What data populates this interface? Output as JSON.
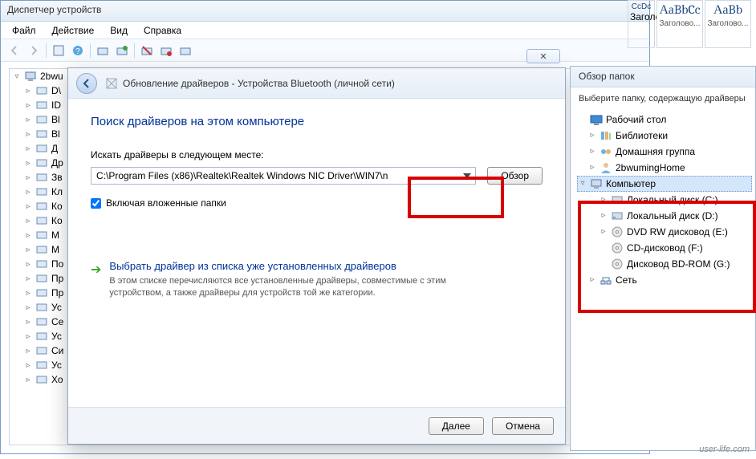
{
  "devmgr": {
    "title": "Диспетчер устройств",
    "menu": [
      "Файл",
      "Действие",
      "Вид",
      "Справка"
    ],
    "root": "2bwu",
    "nodes": [
      "D\\",
      "ID",
      "Bl",
      "Bl",
      "Д",
      "Др",
      "Зв",
      "Кл",
      "Ко",
      "Ко",
      "М",
      "М",
      "По",
      "Пр",
      "Пр",
      "Ус",
      "Се",
      "Ус",
      "Си",
      "Ус",
      "Хо"
    ]
  },
  "wizard": {
    "header_icon_label": "device-placeholder-icon",
    "header_title": "Обновление драйверов - Устройства Bluetooth (личной сети)",
    "h1": "Поиск драйверов на этом компьютере",
    "search_label": "Искать драйверы в следующем месте:",
    "path_value": "C:\\Program Files (x86)\\Realtek\\Realtek Windows NIC Driver\\WIN7\\n",
    "browse_btn": "Обзор",
    "checkbox_label": "Включая вложенные папки",
    "link_title": "Выбрать драйвер из списка уже установленных драйверов",
    "link_desc": "В этом списке перечисляются все установленные драйверы, совместимые с этим устройством, а также драйверы для устройств той же категории.",
    "next": "Далее",
    "cancel": "Отмена",
    "close_sys": "✕"
  },
  "word": {
    "style1_sample": "АаBbCc",
    "style1_label": "Заголово...",
    "style2_sample": "АаBb",
    "style2_label": "Заголово...",
    "ccdc": "CcDc"
  },
  "browse": {
    "title": "Обзор папок",
    "subtitle": "Выберите папку, содержащую драйверы",
    "items": [
      {
        "label": "Рабочий стол",
        "indent": 0,
        "ex": "",
        "icon": "desktop"
      },
      {
        "label": "Библиотеки",
        "indent": 1,
        "ex": "▹",
        "icon": "libraries"
      },
      {
        "label": "Домашняя группа",
        "indent": 1,
        "ex": "▹",
        "icon": "homegroup"
      },
      {
        "label": "2bwumingHome",
        "indent": 1,
        "ex": "▹",
        "icon": "user"
      },
      {
        "label": "Компьютер",
        "indent": 1,
        "ex": "▿",
        "icon": "computer",
        "sel": true
      },
      {
        "label": "Локальный диск (C:)",
        "indent": 2,
        "ex": "▹",
        "icon": "hdd"
      },
      {
        "label": "Локальный диск (D:)",
        "indent": 2,
        "ex": "▹",
        "icon": "hdd"
      },
      {
        "label": "DVD RW дисковод (E:)",
        "indent": 2,
        "ex": "▹",
        "icon": "optical"
      },
      {
        "label": "CD-дисковод (F:)",
        "indent": 2,
        "ex": "",
        "icon": "optical"
      },
      {
        "label": "Дисковод BD-ROM (G:)",
        "indent": 2,
        "ex": "",
        "icon": "optical"
      },
      {
        "label": "Сеть",
        "indent": 1,
        "ex": "▹",
        "icon": "network"
      }
    ]
  },
  "watermark": "user-life.com"
}
